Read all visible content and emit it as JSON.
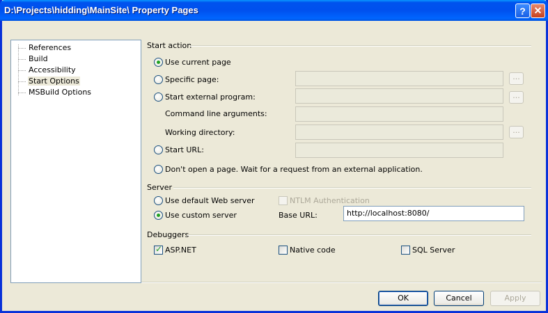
{
  "window": {
    "title": "D:\\Projects\\hidding\\MainSite\\ Property Pages",
    "help_label": "?",
    "close_label": "✕"
  },
  "tree": {
    "items": [
      {
        "label": "References"
      },
      {
        "label": "Build"
      },
      {
        "label": "Accessibility"
      },
      {
        "label": "Start Options",
        "selected": true
      },
      {
        "label": "MSBuild Options"
      }
    ]
  },
  "start_action": {
    "group_label": "Start action",
    "use_current_page": "Use current page",
    "specific_page": "Specific page:",
    "start_external_program": "Start external program:",
    "command_line_arguments": "Command line arguments:",
    "working_directory": "Working directory:",
    "start_url": "Start URL:",
    "dont_open": "Don't open a page. Wait for a request from an external application.",
    "browse_label": "...",
    "selected": "use_current_page"
  },
  "server": {
    "group_label": "Server",
    "use_default_web_server": "Use default Web server",
    "ntlm_authentication": "NTLM Authentication",
    "use_custom_server": "Use custom server",
    "base_url_label": "Base URL:",
    "base_url_value": "http://localhost:8080/",
    "selected": "use_custom_server"
  },
  "debuggers": {
    "group_label": "Debuggers",
    "aspnet": "ASP.NET",
    "native_code": "Native code",
    "sql_server": "SQL Server",
    "aspnet_checked": true,
    "native_checked": false,
    "sql_checked": false
  },
  "buttons": {
    "ok": "OK",
    "cancel": "Cancel",
    "apply": "Apply"
  }
}
